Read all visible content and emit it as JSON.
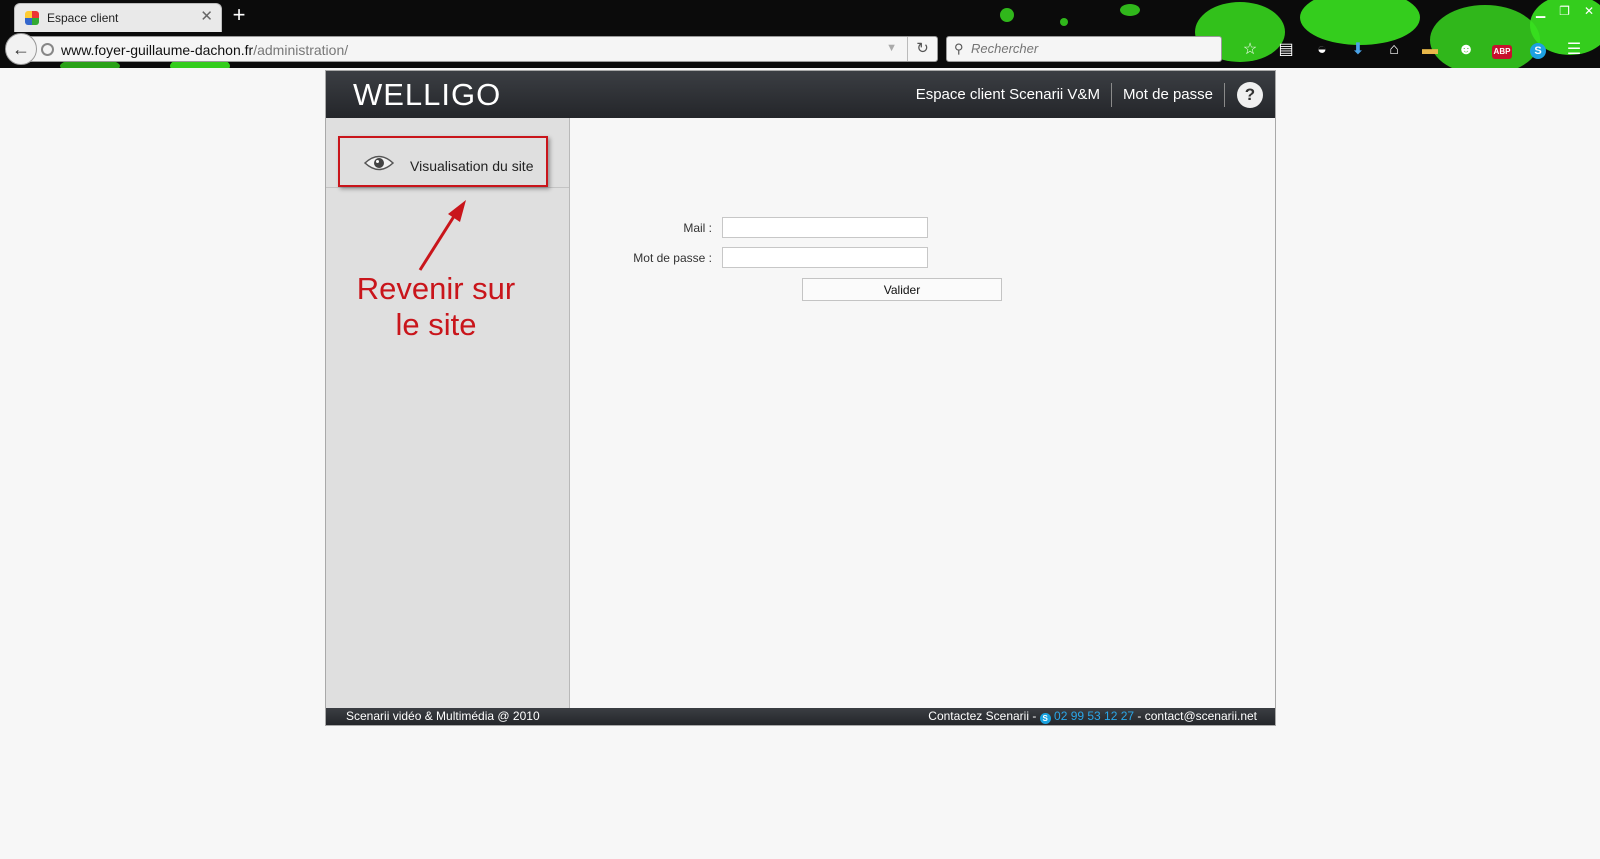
{
  "browser": {
    "tab_title": "Espace client",
    "new_tab_symbol": "+",
    "url_domain": "www.foyer-guillaume-dachon.fr",
    "url_path": "/administration/",
    "search_placeholder": "Rechercher",
    "toolbar_icons": [
      "star-icon",
      "reading-list-icon",
      "pocket-icon",
      "download-icon",
      "home-icon",
      "folder-icon",
      "emoji-icon",
      "adblock-icon",
      "skype-icon",
      "menu-icon"
    ],
    "adblock_label": "ABP",
    "skype_label": "S"
  },
  "app": {
    "logo": "WELLIGO",
    "nav": {
      "espace_client": "Espace client Scenarii V&M",
      "password": "Mot de passe",
      "help": "?"
    },
    "sidebar": {
      "item_label": "Visualisation du site"
    },
    "annotation": {
      "line1": "Revenir sur",
      "line2": "le site",
      "color": "#c9151b"
    },
    "form": {
      "mail_label": "Mail :",
      "mail_value": "",
      "password_label": "Mot de passe :",
      "password_value": "",
      "submit_label": "Valider"
    },
    "footer": {
      "copyright": "Scenarii vidéo & Multimédia @ 2010",
      "contact_prefix": "Contactez Scenarii - ",
      "phone": "02 99 53 12 27",
      "email_suffix": " - contact@scenarii.net"
    }
  }
}
